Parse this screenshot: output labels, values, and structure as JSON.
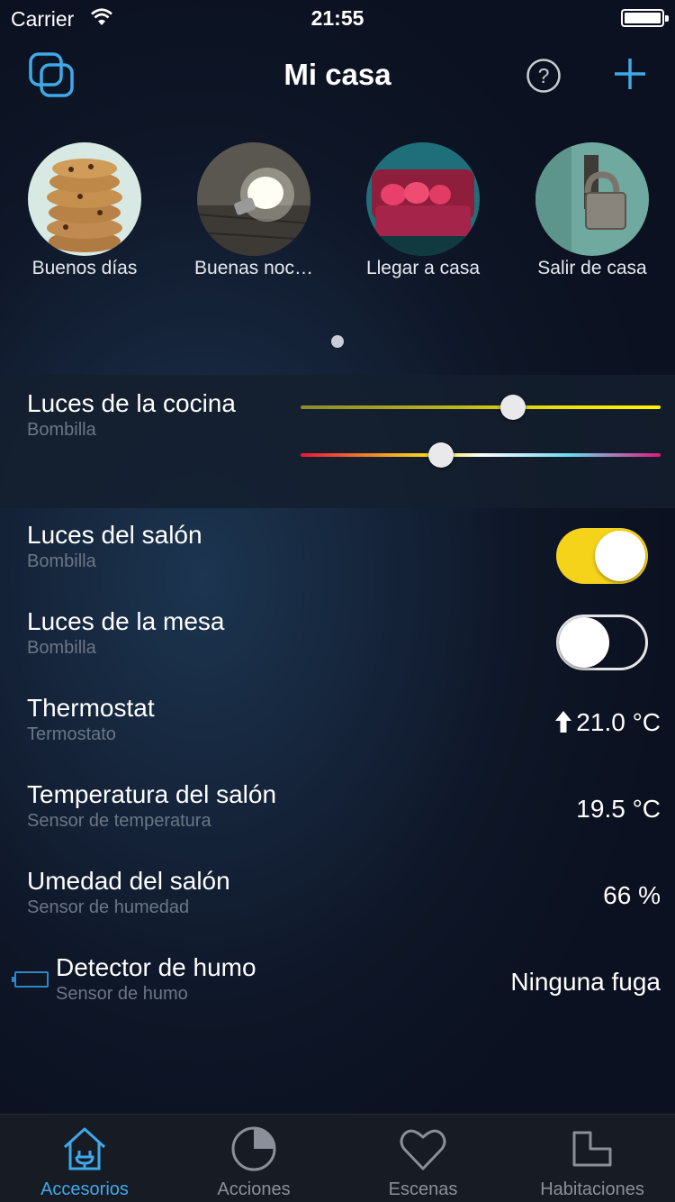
{
  "status_bar": {
    "carrier": "Carrier",
    "time": "21:55"
  },
  "nav": {
    "title": "Mi casa",
    "help_icon": "question-circle-icon",
    "add_icon": "plus-icon",
    "home_switch_icon": "stacked-squares-icon"
  },
  "scenes": [
    {
      "label": "Buenos días",
      "image": "cookies"
    },
    {
      "label": "Buenas noc…",
      "image": "lightbulb"
    },
    {
      "label": "Llegar a casa",
      "image": "red-sofa"
    },
    {
      "label": "Salir de casa",
      "image": "padlock"
    }
  ],
  "scenes_page": {
    "current": 1,
    "total": 1
  },
  "accessories": [
    {
      "name": "Luces de la cocina",
      "type": "Bombilla",
      "brightness": 0.59,
      "hue": 0.39
    },
    {
      "name": "Luces del salón",
      "type": "Bombilla",
      "on": true
    },
    {
      "name": "Luces de la mesa",
      "type": "Bombilla",
      "on": false
    },
    {
      "name": "Thermostat",
      "type": "Termostato",
      "value": "21.0 °C",
      "trend_icon": "arrow-up-icon"
    },
    {
      "name": "Temperatura del salón",
      "type": "Sensor de temperatura",
      "value": "19.5 °C"
    },
    {
      "name": "Umedad del salón",
      "type": "Sensor de humedad",
      "value": "66 %"
    },
    {
      "name": "Detector de humo",
      "type": "Sensor de humo",
      "value": "Ninguna fuga",
      "status_icon": "low-battery-icon"
    }
  ],
  "tabs": [
    {
      "label": "Accesorios",
      "icon": "house-plug-icon",
      "active": true
    },
    {
      "label": "Acciones",
      "icon": "pie-clock-icon",
      "active": false
    },
    {
      "label": "Escenas",
      "icon": "heart-icon",
      "active": false
    },
    {
      "label": "Habitaciones",
      "icon": "room-icon",
      "active": false
    }
  ],
  "colors": {
    "accent": "#3fa9e9",
    "toggle_on": "#f6d31b",
    "background": "#101a2b"
  }
}
